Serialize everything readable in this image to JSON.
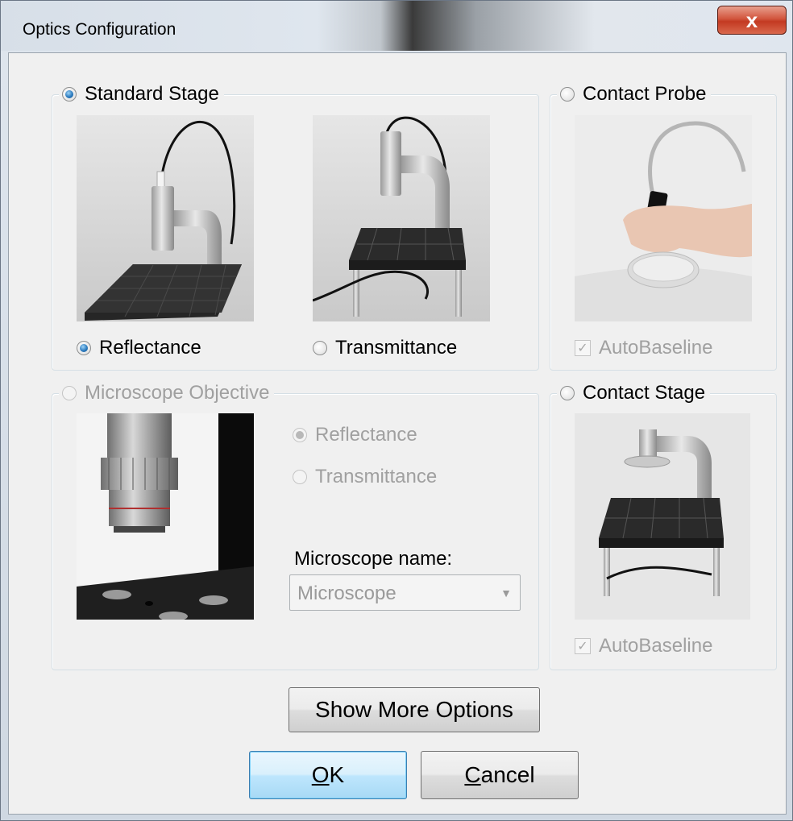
{
  "window": {
    "title": "Optics Configuration",
    "close_glyph": "x"
  },
  "standard_stage": {
    "label": "Standard Stage",
    "selected": true,
    "reflectance_label": "Reflectance",
    "reflectance_selected": true,
    "transmittance_label": "Transmittance",
    "transmittance_selected": false
  },
  "contact_probe": {
    "label": "Contact Probe",
    "selected": false,
    "autobaseline_label": "AutoBaseline",
    "autobaseline_checked": true,
    "autobaseline_check_glyph": "✓"
  },
  "microscope_objective": {
    "label": "Microscope Objective",
    "enabled": false,
    "reflectance_label": "Reflectance",
    "transmittance_label": "Transmittance",
    "name_label": "Microscope name:",
    "name_value": "Microscope",
    "dropdown_glyph": "▼"
  },
  "contact_stage": {
    "label": "Contact Stage",
    "selected": false,
    "autobaseline_label": "AutoBaseline",
    "autobaseline_checked": true,
    "autobaseline_check_glyph": "✓"
  },
  "buttons": {
    "show_more": "Show More Options",
    "ok_mnemonic": "O",
    "ok_rest": "K",
    "cancel_mnemonic": "C",
    "cancel_rest": "ancel"
  },
  "colors": {
    "accent": "#2c7bbf",
    "disabled_text": "#a0a0a0",
    "close_button": "#c33a22"
  }
}
